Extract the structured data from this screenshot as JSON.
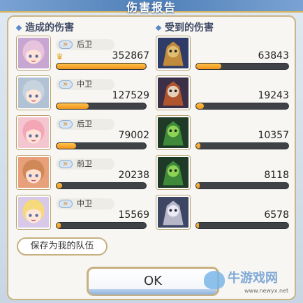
{
  "header": {
    "title": "伤害报告"
  },
  "dealt": {
    "title": "造成的伤害",
    "rows": [
      {
        "role": "后卫",
        "damage": "352867",
        "progress": 1.0,
        "mvp": true,
        "colors": {
          "hair": "#e7c3dd",
          "bg": "#c7a7d2",
          "skin": "#ffe3d6"
        }
      },
      {
        "role": "中卫",
        "damage": "127529",
        "progress": 0.36,
        "mvp": false,
        "colors": {
          "hair": "#c8d3e0",
          "bg": "#b2c2d5",
          "skin": "#ffe7da"
        }
      },
      {
        "role": "后卫",
        "damage": "79002",
        "progress": 0.22,
        "mvp": false,
        "colors": {
          "hair": "#f2a6b6",
          "bg": "#f4c6cf",
          "skin": "#ffe3d6"
        }
      },
      {
        "role": "前卫",
        "damage": "20238",
        "progress": 0.06,
        "mvp": false,
        "colors": {
          "hair": "#d08858",
          "bg": "#e8a07b",
          "skin": "#ffe0cf"
        }
      },
      {
        "role": "中卫",
        "damage": "15569",
        "progress": 0.045,
        "mvp": false,
        "colors": {
          "hair": "#f5d97a",
          "bg": "#d8c9e8",
          "skin": "#ffe7da"
        }
      }
    ]
  },
  "received": {
    "title": "受到的伤害",
    "rows": [
      {
        "damage": "63843",
        "progress": 0.27,
        "colors": {
          "body": "#c08b3c",
          "bg": "#2f3c67",
          "accent": "#e6c57a"
        }
      },
      {
        "damage": "19243",
        "progress": 0.08,
        "colors": {
          "body": "#b0552e",
          "bg": "#3b3048",
          "accent": "#f1e6d2"
        }
      },
      {
        "damage": "10357",
        "progress": 0.045,
        "colors": {
          "body": "#3f8a3a",
          "bg": "#1f3a26",
          "accent": "#9be05a"
        }
      },
      {
        "damage": "8118",
        "progress": 0.035,
        "colors": {
          "body": "#3f8a3a",
          "bg": "#1f3a26",
          "accent": "#9be05a"
        }
      },
      {
        "damage": "6578",
        "progress": 0.028,
        "colors": {
          "body": "#b7b7c9",
          "bg": "#3d4763",
          "accent": "#f5f5ff"
        }
      }
    ]
  },
  "buttons": {
    "save": "保存为我的队伍",
    "ok": "OK"
  },
  "watermark": {
    "text": "牛游戏网",
    "url": "www.newyx.net"
  },
  "icons": {
    "crown": "crown-icon",
    "role": "role-arrows-icon"
  }
}
